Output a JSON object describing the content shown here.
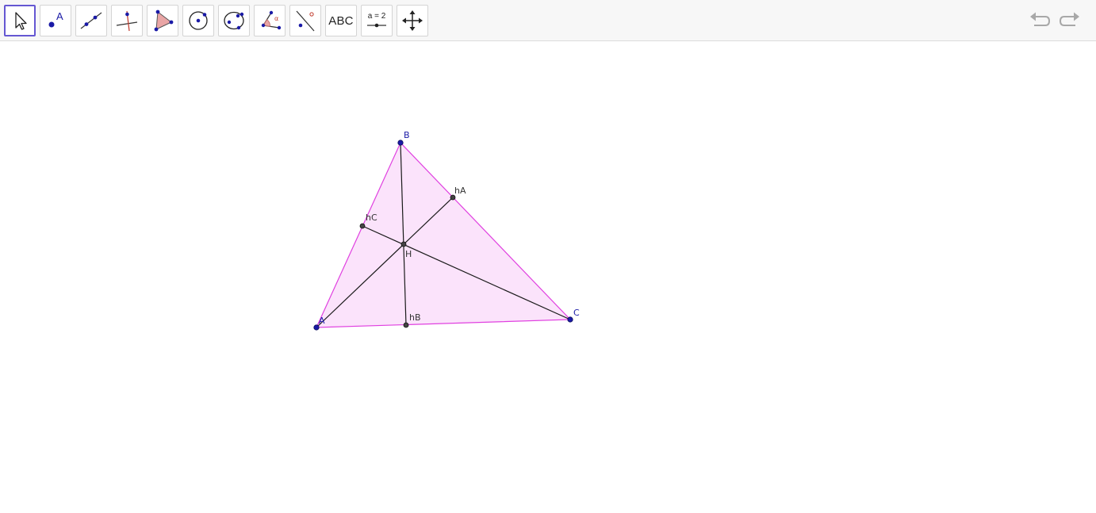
{
  "toolbar": {
    "tools": [
      {
        "name": "move-tool",
        "icon": "cursor-arrow-icon"
      },
      {
        "name": "point-tool",
        "icon": "point-icon",
        "label": "A"
      },
      {
        "name": "line-tool",
        "icon": "line-through-points-icon"
      },
      {
        "name": "perpendicular-line-tool",
        "icon": "perpendicular-line-icon"
      },
      {
        "name": "polygon-tool",
        "icon": "polygon-icon"
      },
      {
        "name": "circle-tool",
        "icon": "circle-center-point-icon"
      },
      {
        "name": "ellipse-tool",
        "icon": "ellipse-icon"
      },
      {
        "name": "angle-tool",
        "icon": "angle-icon",
        "label": "α"
      },
      {
        "name": "reflect-tool",
        "icon": "reflect-about-line-icon"
      },
      {
        "name": "text-tool",
        "icon": "text-icon",
        "label": "ABC"
      },
      {
        "name": "slider-tool",
        "icon": "slider-icon",
        "label": "a = 2"
      },
      {
        "name": "move-graphics-view-tool",
        "icon": "move-arrows-icon"
      }
    ],
    "undo_icon": "undo-icon",
    "redo_icon": "redo-icon"
  },
  "construction": {
    "points": {
      "A": "A",
      "B": "B",
      "C": "C",
      "H": "H",
      "hA": "hA",
      "hB": "hB",
      "hC": "hC"
    },
    "colors": {
      "triangle_fill": "#fbe3fb",
      "triangle_edge": "#e040e0",
      "vertex": "#1a1aa6",
      "vertex_label": "#1a1aa6",
      "altitude": "#1a1a1a",
      "foot_point": "#333333",
      "accent": "#6557d2"
    }
  }
}
